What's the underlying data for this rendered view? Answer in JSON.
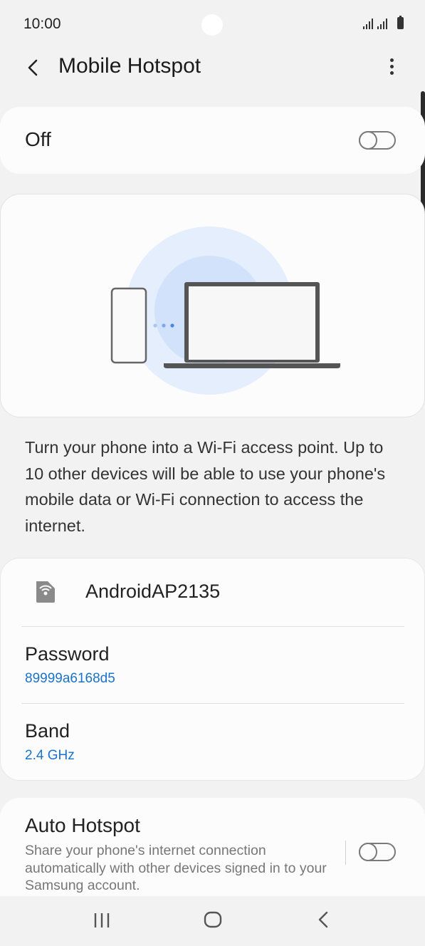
{
  "status_bar": {
    "time": "10:00"
  },
  "app_bar": {
    "title": "Mobile Hotspot"
  },
  "hotspot_toggle": {
    "label": "Off",
    "enabled": false
  },
  "description": "Turn your phone into a Wi-Fi access point. Up to 10 other devices will be able to use your phone's mobile data or Wi-Fi connection to access the internet.",
  "network": {
    "name": "AndroidAP2135",
    "password_label": "Password",
    "password_value": "89999a6168d5",
    "band_label": "Band",
    "band_value": "2.4 GHz"
  },
  "auto_hotspot": {
    "title": "Auto Hotspot",
    "description": "Share your phone's internet connection automatically with other devices signed in to your Samsung account.",
    "enabled": false
  },
  "icons": {
    "back": "back-arrow-icon",
    "more": "more-vertical-icon",
    "network": "hotspot-network-icon",
    "nav_recents": "recents-icon",
    "nav_home": "home-icon",
    "nav_back": "nav-back-icon"
  },
  "colors": {
    "accent": "#1a73c8",
    "background": "#f2f2f2",
    "card": "#fcfcfc",
    "illustration_circle": "#dfeafb"
  }
}
